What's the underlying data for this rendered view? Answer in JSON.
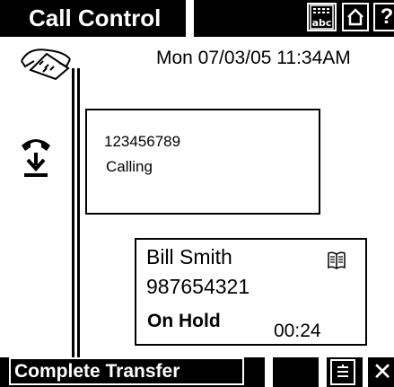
{
  "title_bar": {
    "title": "Call Control",
    "keyboard_icon": "keyboard-abc-icon",
    "home_icon": "home-icon",
    "help_label": "?"
  },
  "status": {
    "datetime": "Mon 07/03/05 11:34AM"
  },
  "icons": {
    "phone": "telephone-icon",
    "hold": "hold-handset-icon",
    "book": "directory-book-icon"
  },
  "calling_call": {
    "number": "123456789",
    "state": "Calling"
  },
  "held_call": {
    "name": "Bill Smith",
    "number": "987654321",
    "state": "On Hold",
    "duration": "00:24"
  },
  "bottom_bar": {
    "complete_transfer_label": "Complete Transfer",
    "menu_icon": "menu-list-icon",
    "close_label": "✕"
  }
}
